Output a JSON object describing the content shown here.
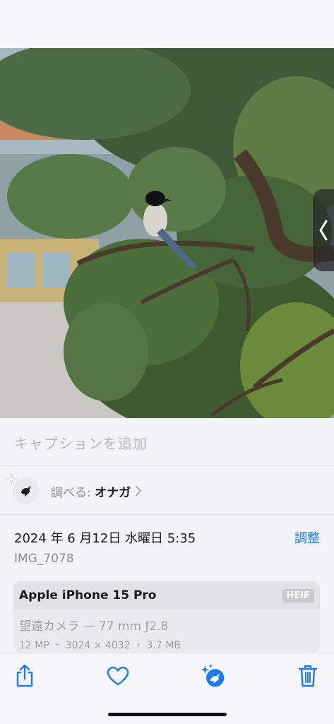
{
  "caption": {
    "placeholder": "キャプションを追加"
  },
  "lookup": {
    "prefix": "調べる: ",
    "subject": "オナガ"
  },
  "info": {
    "date": "2024 年 6 月12日 水曜日 5:35",
    "adjust_label": "調整",
    "filename": "IMG_7078"
  },
  "camera": {
    "device": "Apple iPhone 15 Pro",
    "format": "HEIF",
    "lens": "望遠カメラ — 77 mm ƒ2.8",
    "specs": "12 MP ・ 3024 × 4032 ・ 3.7 MB"
  },
  "toolbar": {
    "icons": [
      "share-icon",
      "heart-icon",
      "visual-lookup-icon",
      "trash-icon"
    ]
  },
  "colors": {
    "accent": "#1a7cf3",
    "secondary_text": "#8e8e93"
  }
}
